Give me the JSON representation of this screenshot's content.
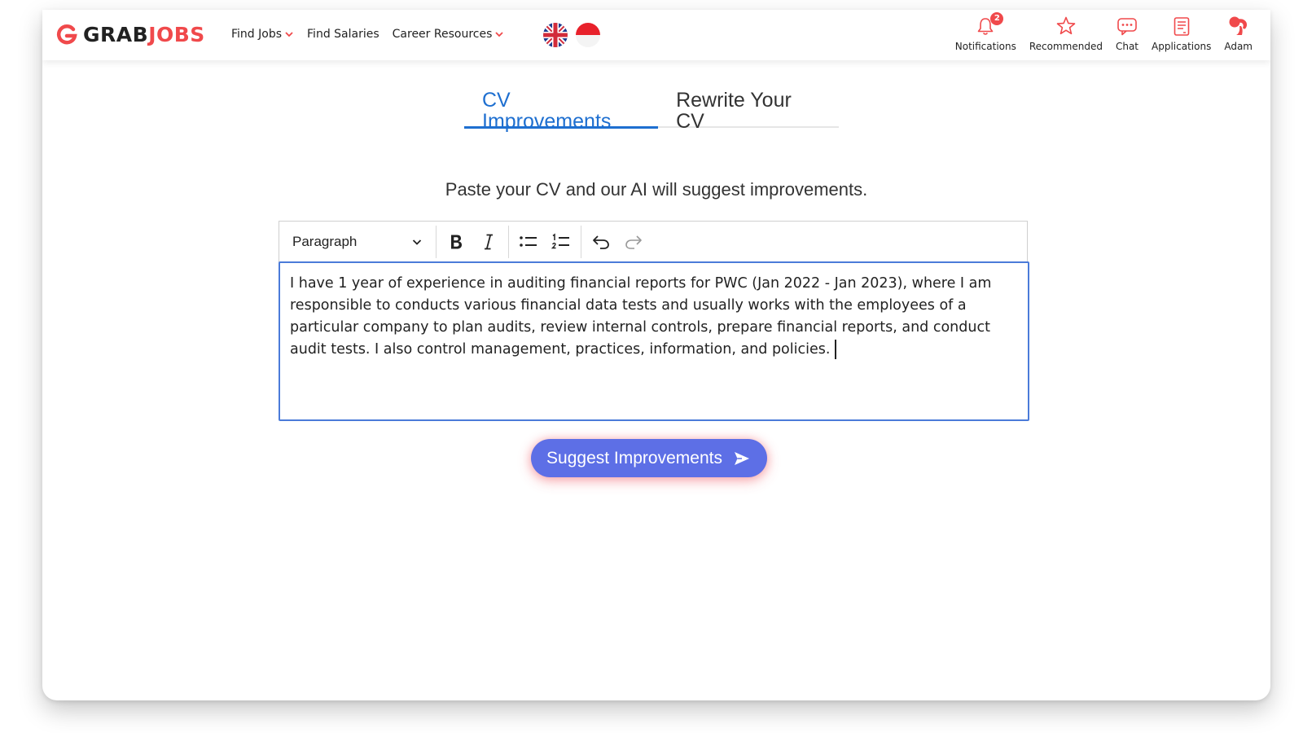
{
  "brand": {
    "part1": "GRAB",
    "part2": "JOBS",
    "accent": "#f0494b"
  },
  "nav": {
    "links": [
      {
        "label": "Find Jobs",
        "has_dropdown": true
      },
      {
        "label": "Find Salaries",
        "has_dropdown": false
      },
      {
        "label": "Career Resources",
        "has_dropdown": true
      }
    ],
    "flags": [
      "uk-flag",
      "indonesia-flag"
    ],
    "right": [
      {
        "label": "Notifications",
        "icon": "bell-icon",
        "badge": "2"
      },
      {
        "label": "Recommended",
        "icon": "star-icon"
      },
      {
        "label": "Chat",
        "icon": "chat-icon"
      },
      {
        "label": "Applications",
        "icon": "clipboard-icon"
      },
      {
        "label": "Adam",
        "icon": "avatar-icon"
      }
    ]
  },
  "tabs": [
    {
      "label": "CV Improvements",
      "active": true
    },
    {
      "label": "Rewrite Your CV",
      "active": false
    }
  ],
  "subtitle": "Paste your CV and our AI will suggest improvements.",
  "editor": {
    "block_format": "Paragraph",
    "tools": [
      "bold-icon",
      "italic-icon",
      "bullet-list-icon",
      "numbered-list-icon",
      "undo-icon",
      "redo-icon"
    ],
    "content": "I have 1 year of experience in auditing financial reports for PWC (Jan 2022 - Jan 2023), where I am responsible to conducts various financial data tests and usually works with the employees of a particular company to plan audits, review internal controls, prepare financial reports, and conduct audit tests. I also control management, practices, information, and policies."
  },
  "actions": {
    "suggest_label": "Suggest Improvements"
  },
  "colors": {
    "primary_tab": "#1e6fd0",
    "button": "#5d6fe6",
    "editor_border": "#4b7bd9"
  }
}
